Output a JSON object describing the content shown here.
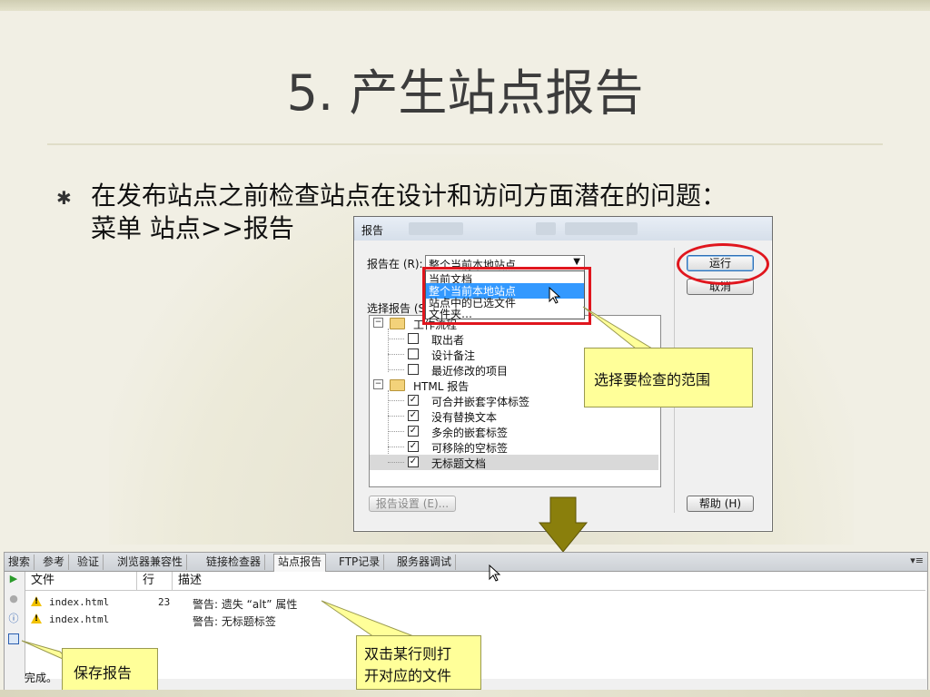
{
  "slide": {
    "title": "5. 产生站点报告",
    "bullet_line1": "在发布站点之前检查站点在设计和访问方面潜在的问题：",
    "bullet_line2": "菜单 站点>>报告",
    "bullet_icon": "asterisk-bullet-icon"
  },
  "dialog": {
    "title": "报告",
    "report_on_label": "报告在 (R):",
    "report_on_value": "整个当前本地站点",
    "dropdown_options": [
      "当前文档",
      "整个当前本地站点",
      "站点中的已选文件",
      "文件夹…"
    ],
    "dropdown_selected_index": 1,
    "select_report_label": "选择报告 (S",
    "tree": {
      "workflow": {
        "label": "工作流程",
        "items": [
          {
            "label": "取出者",
            "checked": false
          },
          {
            "label": "设计备注",
            "checked": false
          },
          {
            "label": "最近修改的项目",
            "checked": false
          }
        ]
      },
      "html": {
        "label": "HTML 报告",
        "items": [
          {
            "label": "可合并嵌套字体标签",
            "checked": true
          },
          {
            "label": "没有替换文本",
            "checked": true
          },
          {
            "label": "多余的嵌套标签",
            "checked": true
          },
          {
            "label": "可移除的空标签",
            "checked": true
          },
          {
            "label": "无标题文档",
            "checked": true
          }
        ]
      }
    },
    "run_button": "运行",
    "cancel_button": "取消",
    "report_settings_button": "报告设置 (E)...",
    "help_button": "帮助 (H)"
  },
  "callouts": {
    "scope": "选择要检查的范围",
    "double_click_line1": "双击某行则打",
    "double_click_line2": "开对应的文件",
    "save": "保存报告"
  },
  "panel": {
    "tabs": [
      "搜索",
      "参考",
      "验证",
      "浏览器兼容性",
      "链接检查器",
      "站点报告",
      "FTP记录",
      "服务器调试"
    ],
    "active_tab_index": 5,
    "columns": [
      "文件",
      "行",
      "描述"
    ],
    "rows": [
      {
        "file": "index.html",
        "line": "23",
        "description": "警告: 遗失 “alt” 属性"
      },
      {
        "file": "index.html",
        "line": "",
        "description": "警告: 无标题标签"
      }
    ],
    "status": "完成。"
  },
  "colors": {
    "highlight_red": "#e0161e",
    "callout_yellow": "#ffff99",
    "arrow_olive": "#8a7f0c",
    "selection_blue": "#3399ff"
  }
}
